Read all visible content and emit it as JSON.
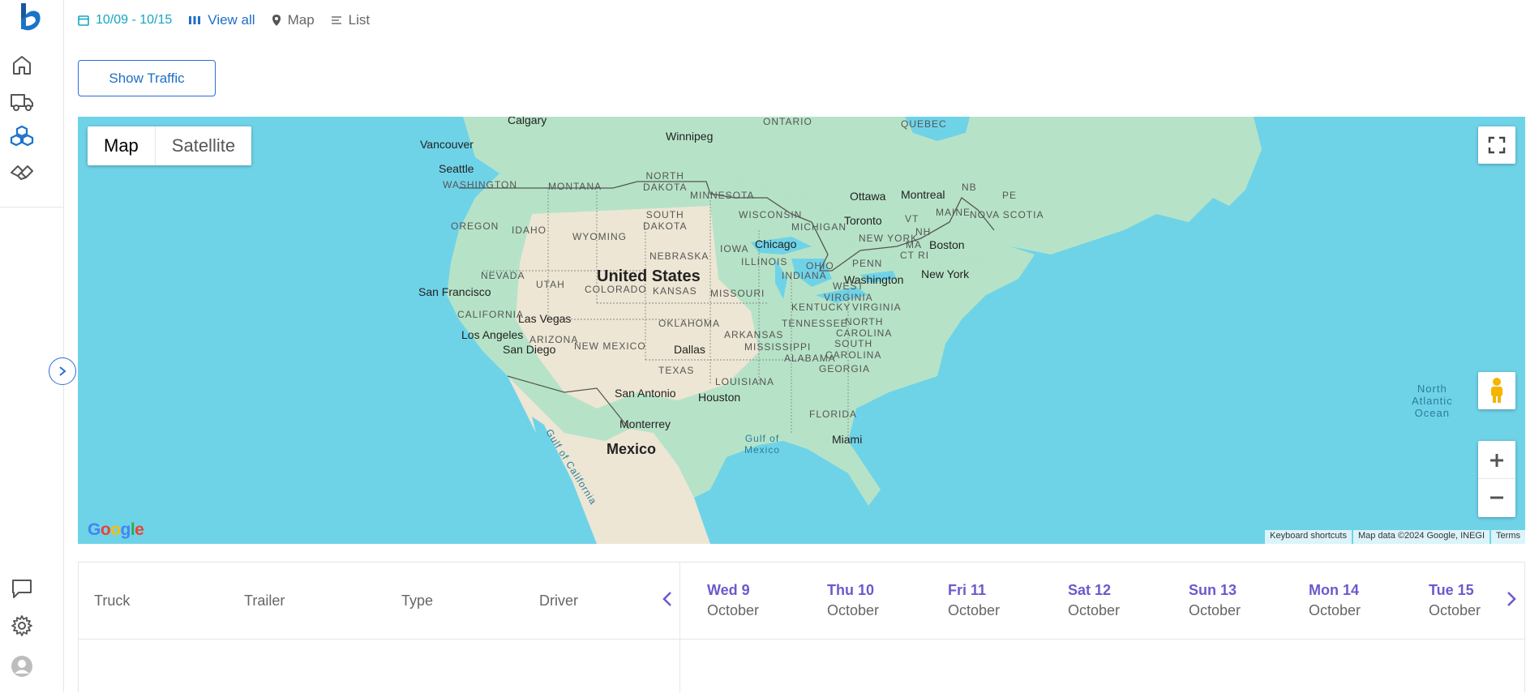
{
  "toolbar": {
    "date_range": "10/09 - 10/15",
    "view_all": "View all",
    "map": "Map",
    "list": "List"
  },
  "traffic_button": "Show Traffic",
  "map": {
    "type_map": "Map",
    "type_satellite": "Satellite",
    "google": "Google",
    "keyboard_shortcuts": "Keyboard shortcuts",
    "map_data": "Map data ©2024 Google, INEGI",
    "terms": "Terms",
    "labels": {
      "country_us": "United States",
      "country_mexico": "Mexico",
      "calgary": "Calgary",
      "vancouver": "Vancouver",
      "seattle": "Seattle",
      "winnipeg": "Winnipeg",
      "ottawa": "Ottawa",
      "montreal": "Montreal",
      "toronto": "Toronto",
      "boston": "Boston",
      "new_york": "New York",
      "washington": "Washington",
      "chicago": "Chicago",
      "san_francisco": "San Francisco",
      "las_vegas": "Las Vegas",
      "los_angeles": "Los Angeles",
      "san_diego": "San Diego",
      "dallas": "Dallas",
      "houston": "Houston",
      "san_antonio": "San Antonio",
      "monterrey": "Monterrey",
      "miami": "Miami",
      "ontario": "ONTARIO",
      "quebec": "QUEBEC",
      "washington_state": "WASHINGTON",
      "oregon": "OREGON",
      "idaho": "IDAHO",
      "montana": "MONTANA",
      "wyoming": "WYOMING",
      "north_dakota": "NORTH\nDAKOTA",
      "south_dakota": "SOUTH\nDAKOTA",
      "minnesota": "MINNESOTA",
      "wisconsin": "WISCONSIN",
      "michigan": "MICHIGAN",
      "nebraska": "NEBRASKA",
      "iowa": "IOWA",
      "illinois": "ILLINOIS",
      "nevada": "NEVADA",
      "utah": "UTAH",
      "colorado": "COLORADO",
      "kansas": "KANSAS",
      "missouri": "MISSOURI",
      "california": "CALIFORNIA",
      "arizona": "ARIZONA",
      "new_mexico": "NEW MEXICO",
      "oklahoma": "OKLAHOMA",
      "arkansas": "ARKANSAS",
      "texas": "TEXAS",
      "louisiana": "LOUISIANA",
      "mississippi": "MISSISSIPPI",
      "alabama": "ALABAMA",
      "georgia": "GEORGIA",
      "florida": "FLORIDA",
      "tennessee": "TENNESSEE",
      "kentucky": "KENTUCKY",
      "indiana": "INDIANA",
      "ohio": "OHIO",
      "penn": "PENN",
      "west_virginia": "WEST\nVIRGINIA",
      "virginia": "VIRGINIA",
      "north_carolina": "NORTH\nCAROLINA",
      "south_carolina": "SOUTH\nCAROLINA",
      "new_york_state": "NEW YORK",
      "vt": "VT",
      "nh": "NH",
      "ma": "MA",
      "ct_ri": "CT RI",
      "maine": "MAINE",
      "nb": "NB",
      "pe": "PE",
      "nova_scotia": "NOVA SCOTIA",
      "north_atlantic_ocean": "North\nAtlantic\nOcean",
      "gulf_of_mexico": "Gulf of\nMexico",
      "gulf_of_california": "Gulf of California"
    }
  },
  "schedule": {
    "columns": [
      "Truck",
      "Trailer",
      "Type",
      "Driver"
    ],
    "days": [
      {
        "name": "Wed 9",
        "month": "October"
      },
      {
        "name": "Thu 10",
        "month": "October"
      },
      {
        "name": "Fri 11",
        "month": "October"
      },
      {
        "name": "Sat 12",
        "month": "October"
      },
      {
        "name": "Sun 13",
        "month": "October"
      },
      {
        "name": "Mon 14",
        "month": "October"
      },
      {
        "name": "Tue 15",
        "month": "October"
      }
    ]
  },
  "colors": {
    "accent": "#1f6fc6",
    "teal": "#14a7c4",
    "day_purple": "#6a5acd",
    "water": "#6fd3e8",
    "land_green": "#b6e3c7",
    "land_tan": "#ede6d4"
  }
}
